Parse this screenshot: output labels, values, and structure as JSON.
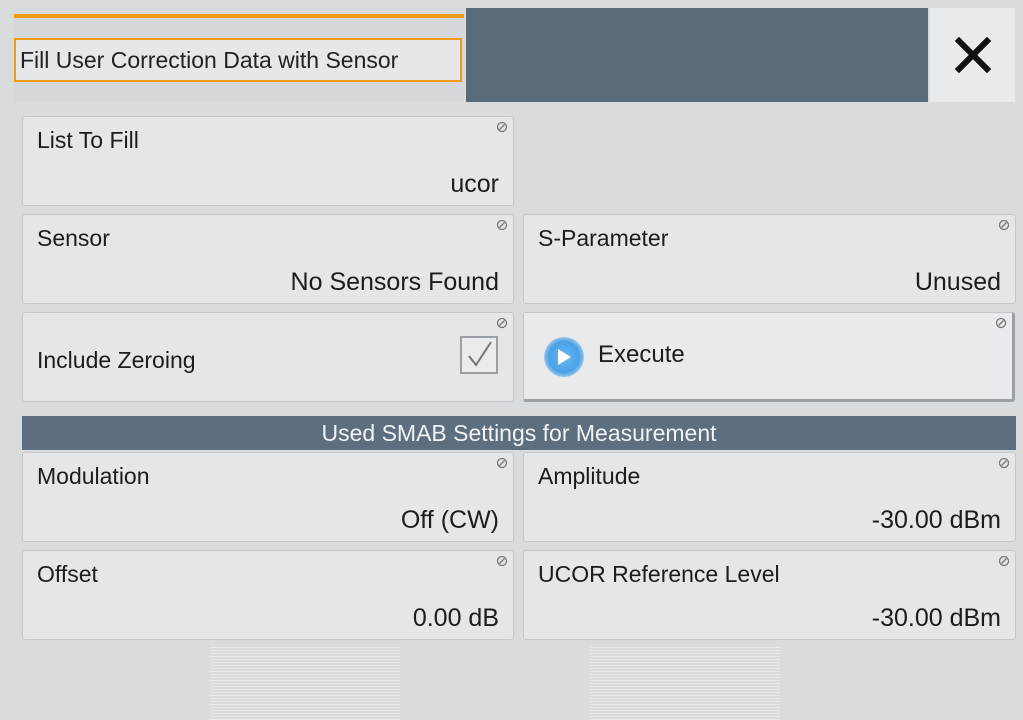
{
  "dialog": {
    "title": "Fill User Correction Data with Sensor",
    "close_icon": "close-icon"
  },
  "fields": {
    "list_to_fill": {
      "label": "List To Fill",
      "value": "ucor"
    },
    "sensor": {
      "label": "Sensor",
      "value": "No Sensors Found"
    },
    "s_parameter": {
      "label": "S-Parameter",
      "value": "Unused"
    },
    "include_zeroing": {
      "label": "Include Zeroing",
      "checked": true
    },
    "execute": {
      "label": "Execute",
      "icon": "play-icon"
    }
  },
  "section": {
    "title": "Used SMAB Settings for Measurement"
  },
  "settings": {
    "modulation": {
      "label": "Modulation",
      "value": "Off (CW)"
    },
    "amplitude": {
      "label": "Amplitude",
      "value": "-30.00 dBm"
    },
    "offset": {
      "label": "Offset",
      "value": "0.00 dB"
    },
    "ucor_reference_level": {
      "label": "UCOR Reference Level",
      "value": "-30.00 dBm"
    }
  },
  "colors": {
    "accent": "#f39c12",
    "header_dark": "#5a6b7a",
    "section_bar": "#5d6e7e",
    "tile_bg": "#e4e6e8",
    "execute_icon": "#4aa2e8"
  }
}
